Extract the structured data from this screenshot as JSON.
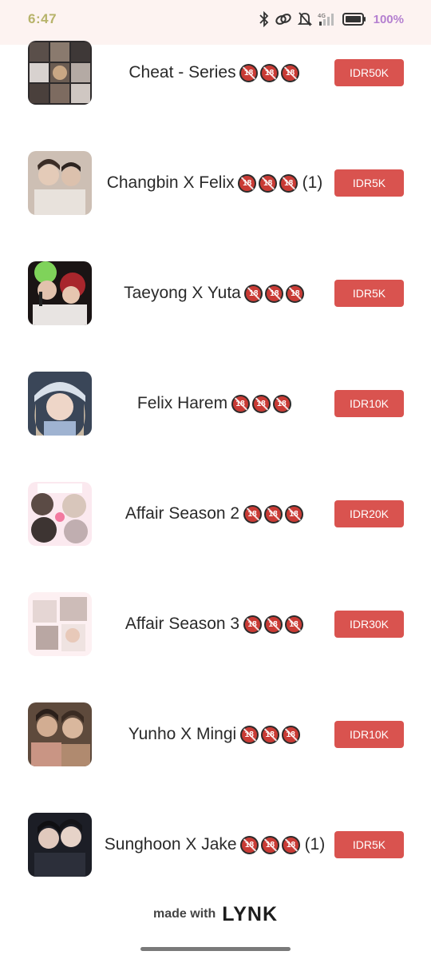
{
  "status_bar": {
    "time": "6:47",
    "battery": "100%",
    "icons": [
      "bluetooth-icon",
      "link-icon",
      "bell-muted-icon",
      "signal-icon",
      "battery-icon"
    ]
  },
  "products": [
    {
      "title": "Cheat - Series",
      "badges": 3,
      "suffix": "",
      "price": "IDR50K"
    },
    {
      "title": "Changbin X Felix",
      "badges": 3,
      "suffix": "(1)",
      "price": "IDR5K"
    },
    {
      "title": "Taeyong X Yuta",
      "badges": 3,
      "suffix": "",
      "price": "IDR5K"
    },
    {
      "title": "Felix Harem",
      "badges": 3,
      "suffix": "",
      "price": "IDR10K"
    },
    {
      "title": "Affair Season 2",
      "badges": 3,
      "suffix": "",
      "price": "IDR20K"
    },
    {
      "title": "Affair Season 3",
      "badges": 3,
      "suffix": "",
      "price": "IDR30K"
    },
    {
      "title": "Yunho X Mingi",
      "badges": 3,
      "suffix": "",
      "price": "IDR10K"
    },
    {
      "title": "Sunghoon X Jake",
      "badges": 3,
      "suffix": "(1)",
      "price": "IDR5K"
    }
  ],
  "footer": {
    "made_with": "made with",
    "brand": "LYNK"
  },
  "colors": {
    "accent": "#d9534f",
    "status_bar_bg": "#fdf3f1",
    "brand_green": "#1eb26c"
  }
}
